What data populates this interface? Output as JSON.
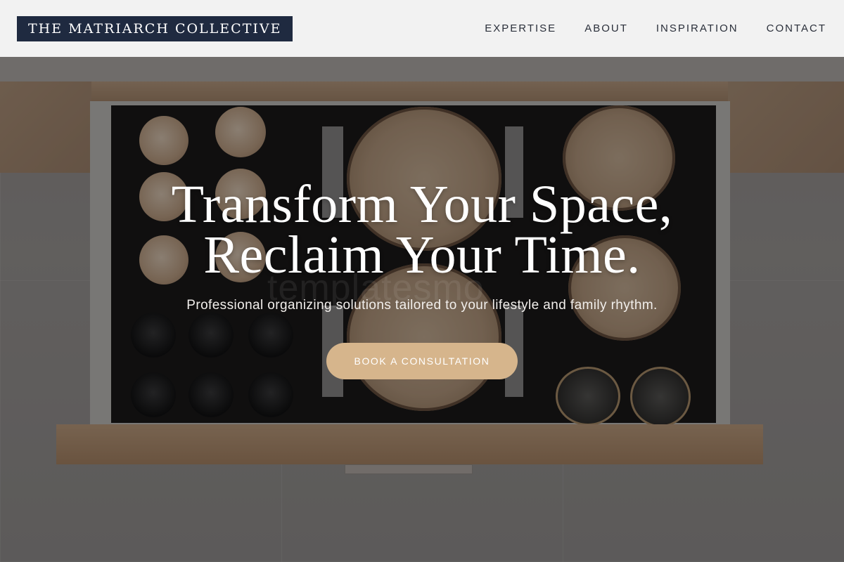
{
  "header": {
    "logo": "THE MATRIARCH COLLECTIVE",
    "nav": [
      "EXPERTISE",
      "ABOUT",
      "INSPIRATION",
      "CONTACT"
    ]
  },
  "hero": {
    "title_line1": "Transform Your Space,",
    "title_line2": "Reclaim Your Time.",
    "subtitle": "Professional organizing solutions tailored to your lifestyle and family rhythm.",
    "cta_label": "BOOK A CONSULTATION",
    "watermark": "templatesmo"
  },
  "colors": {
    "logo_bg": "#1f2a40",
    "cta_bg": "#d6b58c",
    "header_bg": "#f7f7f7",
    "nav_text": "#2a2f3a"
  }
}
